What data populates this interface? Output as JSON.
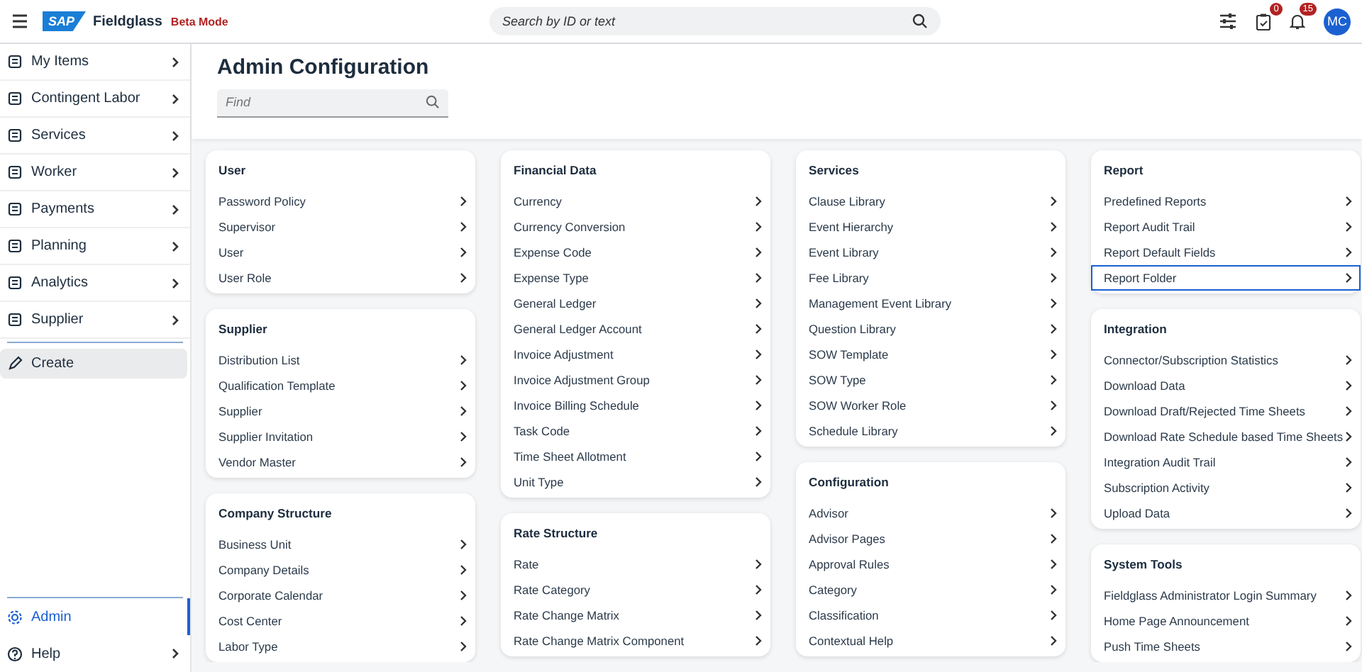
{
  "header": {
    "brand_logo": "SAP",
    "product": "Fieldglass",
    "mode_badge": "Beta Mode",
    "search": {
      "placeholder": "Search by ID or text"
    },
    "tasks_badge": "0",
    "notifications_badge": "15",
    "avatar": "MC"
  },
  "sidebar": {
    "items": [
      {
        "label": "My Items",
        "kind": "menu",
        "selected": false
      },
      {
        "label": "Contingent Labor",
        "kind": "menu",
        "selected": false
      },
      {
        "label": "Services",
        "kind": "menu",
        "selected": false
      },
      {
        "label": "Worker",
        "kind": "menu",
        "selected": false
      },
      {
        "label": "Payments",
        "kind": "menu",
        "selected": false
      },
      {
        "label": "Planning",
        "kind": "menu",
        "selected": false
      },
      {
        "label": "Analytics",
        "kind": "menu",
        "selected": false
      },
      {
        "label": "Supplier",
        "kind": "menu",
        "selected": false
      },
      {
        "label": "Create",
        "kind": "action",
        "selected": false
      }
    ],
    "bottom_items": [
      {
        "label": "Admin",
        "kind": "link",
        "selected": true
      },
      {
        "label": "Help",
        "kind": "menu",
        "selected": false
      }
    ]
  },
  "page": {
    "title": "Admin Configuration",
    "filter": {
      "placeholder": "Find"
    }
  },
  "columns": [
    [
      {
        "title": "User",
        "items": [
          {
            "label": "Password Policy",
            "focused": false
          },
          {
            "label": "Supervisor",
            "focused": false
          },
          {
            "label": "User",
            "focused": false
          },
          {
            "label": "User Role",
            "focused": false
          }
        ]
      },
      {
        "title": "Supplier",
        "items": [
          {
            "label": "Distribution List",
            "focused": false
          },
          {
            "label": "Qualification Template",
            "focused": false
          },
          {
            "label": "Supplier",
            "focused": false
          },
          {
            "label": "Supplier Invitation",
            "focused": false
          },
          {
            "label": "Vendor Master",
            "focused": false
          }
        ]
      },
      {
        "title": "Company Structure",
        "items": [
          {
            "label": "Business Unit",
            "focused": false
          },
          {
            "label": "Company Details",
            "focused": false
          },
          {
            "label": "Corporate Calendar",
            "focused": false
          },
          {
            "label": "Cost Center",
            "focused": false
          },
          {
            "label": "Labor Type",
            "focused": false
          }
        ]
      }
    ],
    [
      {
        "title": "Financial Data",
        "items": [
          {
            "label": "Currency",
            "focused": false
          },
          {
            "label": "Currency Conversion",
            "focused": false
          },
          {
            "label": "Expense Code",
            "focused": false
          },
          {
            "label": "Expense Type",
            "focused": false
          },
          {
            "label": "General Ledger",
            "focused": false
          },
          {
            "label": "General Ledger Account",
            "focused": false
          },
          {
            "label": "Invoice Adjustment",
            "focused": false
          },
          {
            "label": "Invoice Adjustment Group",
            "focused": false
          },
          {
            "label": "Invoice Billing Schedule",
            "focused": false
          },
          {
            "label": "Task Code",
            "focused": false
          },
          {
            "label": "Time Sheet Allotment",
            "focused": false
          },
          {
            "label": "Unit Type",
            "focused": false
          }
        ]
      },
      {
        "title": "Rate Structure",
        "items": [
          {
            "label": "Rate",
            "focused": false
          },
          {
            "label": "Rate Category",
            "focused": false
          },
          {
            "label": "Rate Change Matrix",
            "focused": false
          },
          {
            "label": "Rate Change Matrix Component",
            "focused": false
          }
        ]
      }
    ],
    [
      {
        "title": "Services",
        "items": [
          {
            "label": "Clause Library",
            "focused": false
          },
          {
            "label": "Event Hierarchy",
            "focused": false
          },
          {
            "label": "Event Library",
            "focused": false
          },
          {
            "label": "Fee Library",
            "focused": false
          },
          {
            "label": "Management Event Library",
            "focused": false
          },
          {
            "label": "Question Library",
            "focused": false
          },
          {
            "label": "SOW Template",
            "focused": false
          },
          {
            "label": "SOW Type",
            "focused": false
          },
          {
            "label": "SOW Worker Role",
            "focused": false
          },
          {
            "label": "Schedule Library",
            "focused": false
          }
        ]
      },
      {
        "title": "Configuration",
        "items": [
          {
            "label": "Advisor",
            "focused": false
          },
          {
            "label": "Advisor Pages",
            "focused": false
          },
          {
            "label": "Approval Rules",
            "focused": false
          },
          {
            "label": "Category",
            "focused": false
          },
          {
            "label": "Classification",
            "focused": false
          },
          {
            "label": "Contextual Help",
            "focused": false
          }
        ]
      }
    ],
    [
      {
        "title": "Report",
        "items": [
          {
            "label": "Predefined Reports",
            "focused": false
          },
          {
            "label": "Report Audit Trail",
            "focused": false
          },
          {
            "label": "Report Default Fields",
            "focused": false
          },
          {
            "label": "Report Folder",
            "focused": true
          }
        ]
      },
      {
        "title": "Integration",
        "items": [
          {
            "label": "Connector/Subscription Statistics",
            "focused": false
          },
          {
            "label": "Download Data",
            "focused": false
          },
          {
            "label": "Download Draft/Rejected Time Sheets",
            "focused": false
          },
          {
            "label": "Download Rate Schedule based Time Sheets",
            "focused": false
          },
          {
            "label": "Integration Audit Trail",
            "focused": false
          },
          {
            "label": "Subscription Activity",
            "focused": false
          },
          {
            "label": "Upload Data",
            "focused": false
          }
        ]
      },
      {
        "title": "System Tools",
        "items": [
          {
            "label": "Fieldglass Administrator Login Summary",
            "focused": false
          },
          {
            "label": "Home Page Announcement",
            "focused": false
          },
          {
            "label": "Push Time Sheets",
            "focused": false
          }
        ]
      }
    ]
  ]
}
